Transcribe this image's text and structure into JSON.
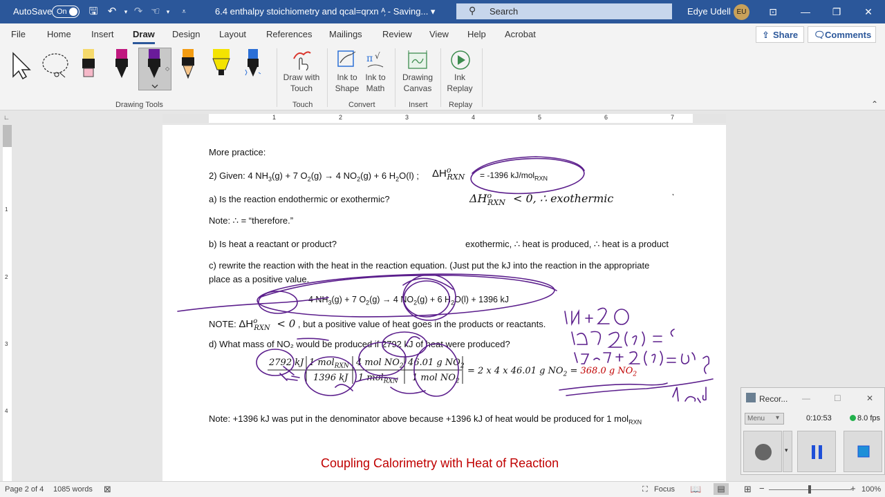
{
  "titlebar": {
    "autosave_label": "AutoSave",
    "autosave_state": "On",
    "doc_title": "6.4 enthalpy stoichiometry and qcal=qrxn",
    "doc_title_suffix": "ᴬ᷊  -  Saving...  ▾",
    "search_placeholder": "Search",
    "user_name": "Edye Udell",
    "user_initials": "EU",
    "brand_color": "#2b579a"
  },
  "menu": {
    "items": [
      "File",
      "Home",
      "Insert",
      "Draw",
      "Design",
      "Layout",
      "References",
      "Mailings",
      "Review",
      "View",
      "Help",
      "Acrobat"
    ],
    "active": "Draw",
    "share_label": "Share",
    "comments_label": "Comments"
  },
  "ribbon": {
    "groups": {
      "drawing_tools": "Drawing Tools",
      "touch": "Touch",
      "convert": "Convert",
      "insert": "Insert",
      "replay": "Replay"
    },
    "buttons": {
      "draw_with_touch": [
        "Draw with",
        "Touch"
      ],
      "ink_to_shape": [
        "Ink to",
        "Shape"
      ],
      "ink_to_math": [
        "Ink to",
        "Math"
      ],
      "drawing_canvas": [
        "Drawing",
        "Canvas"
      ],
      "ink_replay": [
        "Ink",
        "Replay"
      ]
    },
    "pens": [
      {
        "name": "highlighter-yellow",
        "color": "#f5d96b"
      },
      {
        "name": "pen-magenta",
        "color": "#c0187f"
      },
      {
        "name": "pen-purple",
        "color": "#6a1b9a"
      },
      {
        "name": "pencil-orange",
        "color": "#f39c12"
      },
      {
        "name": "highlighter-yellow-2",
        "color": "#f4e300"
      },
      {
        "name": "galaxy-pen-blue",
        "color": "#2b6fd6"
      }
    ]
  },
  "ruler": {
    "numbers": [
      "1",
      "2",
      "3",
      "4",
      "5",
      "6",
      "7"
    ],
    "vnumbers": [
      "1",
      "2",
      "3",
      "4"
    ]
  },
  "document": {
    "l1": "More practice:",
    "l2a": "2) Given:  4 NH",
    "l2b": "(g)  + 7 O",
    "l2c": "(g)  →  4 NO",
    "l2d": "(g) + 6 H",
    "l2e": "O(l) ;",
    "l2_dh": "ΔH",
    "l2_dh_sup": "o",
    "l2_dh_sub": "RXN",
    "l2_value": "= -1396 kJ/mol",
    "l2_value_sub": "RXN",
    "l3": "a) Is the reaction endothermic or exothermic?",
    "l3_ans_dh": "ΔH",
    "l3_ans_sup": "o",
    "l3_ans_sub": "RXN",
    "l3_ans_rest": " < 0,   ∴ exothermic",
    "l4": "Note:   ∴ =  “therefore.”",
    "l5": "b) Is heat a reactant or product?",
    "l5_ans": "exothermic, ∴ heat is produced, ∴ heat is a product",
    "l6a": "c) rewrite the reaction with the heat in the reaction equation.  (Just put the kJ into the reaction in the appropriate",
    "l6b": "place as a positive value.",
    "l7a": "4 NH",
    "l7b": "(g)  + 7 O",
    "l7c": "(g)  →  4 NO",
    "l7d": "(g) + 6 H",
    "l7e": "O(l)   + 1396 kJ",
    "sub3": "3",
    "sub2": "2",
    "l8a": "NOTE: ",
    "l8_dh": "ΔH",
    "l8_sup": "o",
    "l8_sub": "RXN",
    "l8_lt": " < 0",
    "l8_rest": " , but a positive value of heat goes in the products or reactants.",
    "l9": "d) What mass of NO₂ would be produced if 2792 kJ of heat were produced?",
    "f1n": "2792 kJ",
    "f2n": "1 mol",
    "f2n_sub": "RXN",
    "f2d": "1396 kJ",
    "f3n": "4 mol NO",
    "f3d": "1 mol",
    "f3d_sub": "RXN",
    "f4n": "46.01 g NO",
    "f4d": "1 mol NO",
    "eq_rest": "=  2 x 4 x 46.01 g NO",
    "eq_eq": " = ",
    "eq_answer": "368.0 g NO",
    "l10": "Note:  +1396 kJ was put in the denominator above because +1396 kJ of heat would be produced for 1 mol",
    "l10_sub": "RXN",
    "heading": "Coupling Calorimetry with Heat of Reaction",
    "heading_color": "#c00000",
    "ink_color": "#5b1e8c"
  },
  "recorder": {
    "title": "Recor...",
    "menu_label": "Menu",
    "time": "0:10:53",
    "fps": "8.0 fps"
  },
  "status": {
    "page": "Page 2 of 4",
    "words": "1085 words",
    "focus": "Focus",
    "zoom": "100%"
  }
}
